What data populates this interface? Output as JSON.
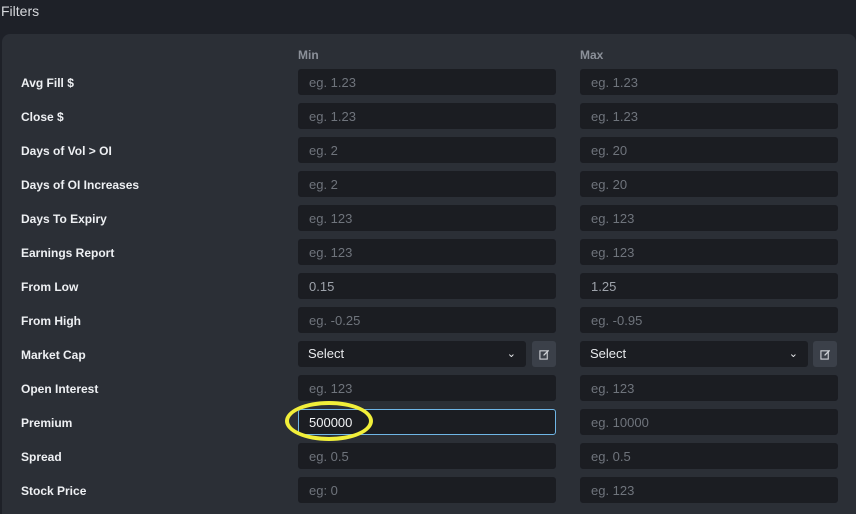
{
  "title": "Filters",
  "columns": {
    "min": "Min",
    "max": "Max"
  },
  "rows": [
    {
      "label": "Avg Fill $",
      "min_value": "",
      "min_placeholder": "eg. 1.23",
      "max_value": "",
      "max_placeholder": "eg. 1.23"
    },
    {
      "label": "Close $",
      "min_value": "",
      "min_placeholder": "eg. 1.23",
      "max_value": "",
      "max_placeholder": "eg. 1.23"
    },
    {
      "label": "Days of Vol > OI",
      "min_value": "",
      "min_placeholder": "eg. 2",
      "max_value": "",
      "max_placeholder": "eg. 20"
    },
    {
      "label": "Days of OI Increases",
      "min_value": "",
      "min_placeholder": "eg. 2",
      "max_value": "",
      "max_placeholder": "eg. 20"
    },
    {
      "label": "Days To Expiry",
      "min_value": "",
      "min_placeholder": "eg. 123",
      "max_value": "",
      "max_placeholder": "eg. 123"
    },
    {
      "label": "Earnings Report",
      "min_value": "",
      "min_placeholder": "eg. 123",
      "max_value": "",
      "max_placeholder": "eg. 123"
    },
    {
      "label": "From Low",
      "min_value": "0.15",
      "min_placeholder": "",
      "max_value": "1.25",
      "max_placeholder": ""
    },
    {
      "label": "From High",
      "min_value": "",
      "min_placeholder": "eg. -0.25",
      "max_value": "",
      "max_placeholder": "eg. -0.95"
    },
    {
      "label": "Market Cap",
      "min_select": "Select",
      "max_select": "Select"
    },
    {
      "label": "Open Interest",
      "min_value": "",
      "min_placeholder": "eg. 123",
      "max_value": "",
      "max_placeholder": "eg. 123"
    },
    {
      "label": "Premium",
      "min_value": "500000",
      "min_placeholder": "",
      "max_value": "",
      "max_placeholder": "eg. 10000"
    },
    {
      "label": "Spread",
      "min_value": "",
      "min_placeholder": "eg. 0.5",
      "max_value": "",
      "max_placeholder": "eg. 0.5"
    },
    {
      "label": "Stock Price",
      "min_value": "",
      "min_placeholder": "eg: 0",
      "max_value": "",
      "max_placeholder": "eg. 123"
    }
  ],
  "colors": {
    "focus_border": "#6fb6e6",
    "annotation": "#f1ef3a"
  }
}
